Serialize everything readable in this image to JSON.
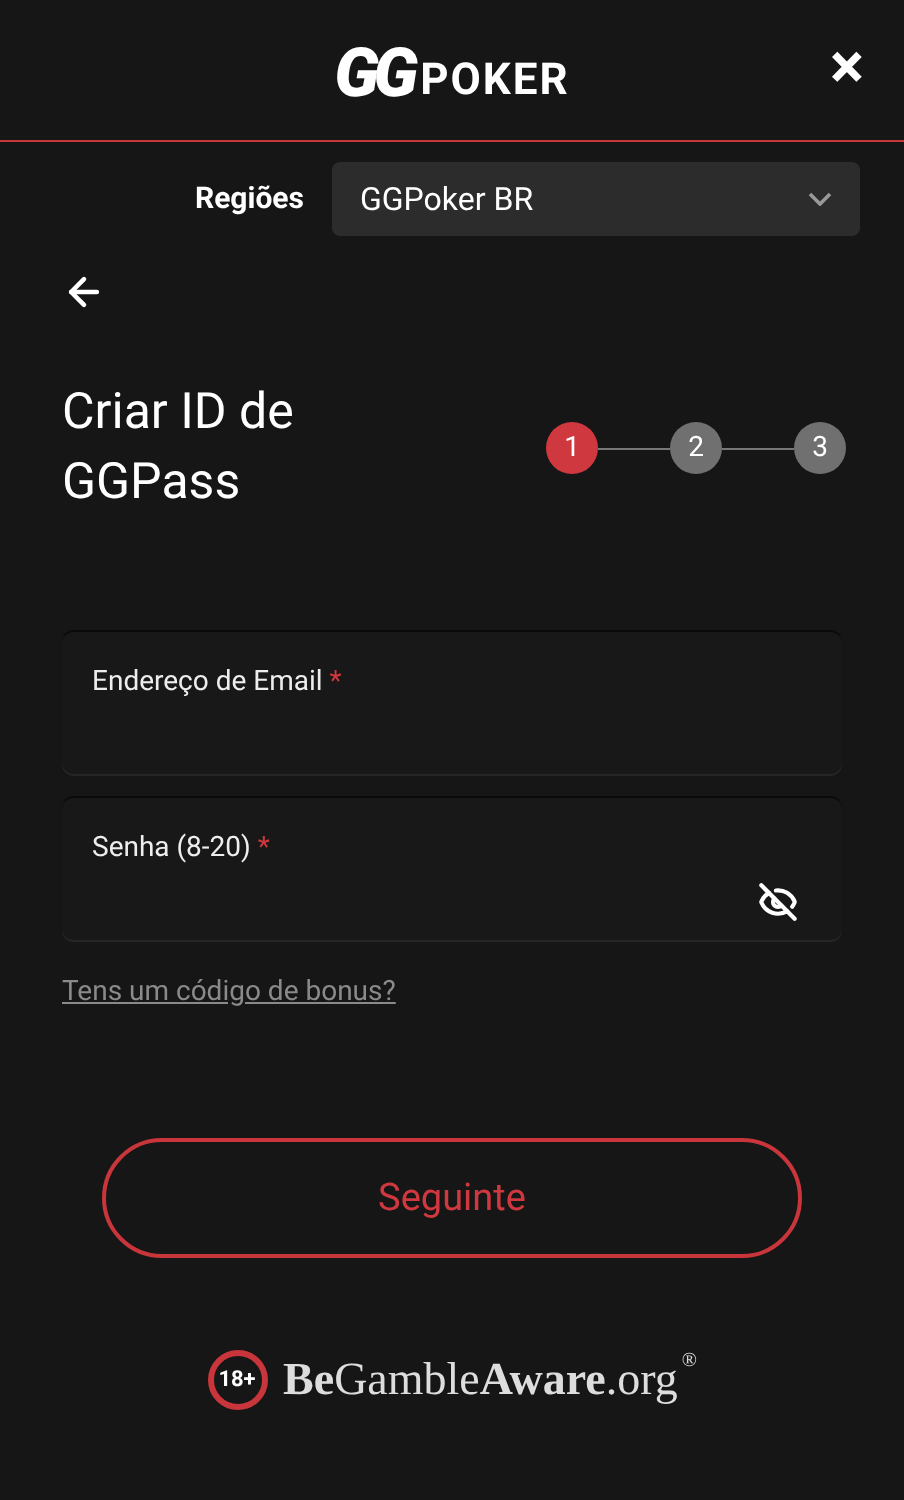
{
  "header": {
    "logo_mark": "GG",
    "logo_word": "POKER",
    "close": "×"
  },
  "region": {
    "label": "Regiões",
    "value": "GGPoker BR"
  },
  "title": "Criar ID de GGPass",
  "steps": [
    {
      "label": "1",
      "selected": true
    },
    {
      "label": "2",
      "selected": false
    },
    {
      "label": "3",
      "selected": false
    }
  ],
  "fields": [
    {
      "kind": "text",
      "label": "Endereço de Email",
      "required": "*"
    },
    {
      "kind": "password",
      "label": "Senha (8-20)",
      "required": "*"
    }
  ],
  "bonus_link": "Tens um código de bonus?",
  "next_button": "Seguinte",
  "footer": {
    "age": "18+",
    "brand": "**Be**Gamble**Aware**.org",
    "registered": "®"
  }
}
